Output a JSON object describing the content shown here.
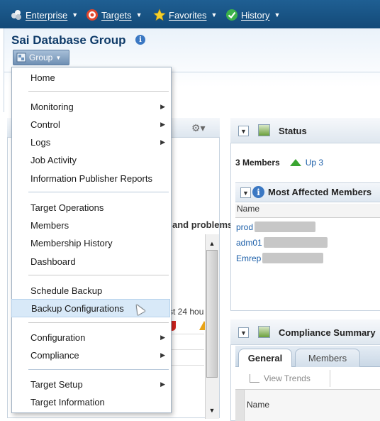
{
  "nav": {
    "items": [
      {
        "label": "Enterprise",
        "icon": "enterprise-icon"
      },
      {
        "label": "Targets",
        "icon": "targets-icon"
      },
      {
        "label": "Favorites",
        "icon": "favorites-star-icon"
      },
      {
        "label": "History",
        "icon": "history-icon"
      }
    ]
  },
  "header": {
    "title": "Sai Database Group",
    "group_button": "Group"
  },
  "menu": {
    "items": [
      {
        "label": "Home",
        "submenu": false
      },
      {
        "label": "Monitoring",
        "submenu": true
      },
      {
        "label": "Control",
        "submenu": true
      },
      {
        "label": "Logs",
        "submenu": true
      },
      {
        "label": "Job Activity",
        "submenu": false
      },
      {
        "label": "Information Publisher Reports",
        "submenu": false
      },
      {
        "label": "Target Operations",
        "submenu": false
      },
      {
        "label": "Members",
        "submenu": false
      },
      {
        "label": "Membership History",
        "submenu": false
      },
      {
        "label": "Dashboard",
        "submenu": false
      },
      {
        "label": "Schedule Backup",
        "submenu": false
      },
      {
        "label": "Backup Configurations",
        "submenu": false,
        "highlighted": true
      },
      {
        "label": "Configuration",
        "submenu": true
      },
      {
        "label": "Compliance",
        "submenu": true
      },
      {
        "label": "Target Setup",
        "submenu": true
      },
      {
        "label": "Target Information",
        "submenu": false
      }
    ],
    "submenu_glyph": "▶"
  },
  "left_panel": {
    "problems_text": "and problems",
    "last24_text": "st 24 hou"
  },
  "status": {
    "title": "Status",
    "members_count": "3 Members",
    "up_text": "Up 3",
    "most_affected_title": "Most Affected Members",
    "name_header": "Name",
    "members": [
      "prod",
      "adm01",
      "Emrep"
    ]
  },
  "compliance": {
    "title": "Compliance Summary",
    "tabs": [
      "General",
      "Members"
    ],
    "view_trends": "View Trends",
    "name_header": "Name"
  },
  "colors": {
    "topbar": "#1a5587",
    "title": "#0e3a68",
    "link": "#1b5ea8",
    "menu_highlight": "#d8e9f8"
  }
}
